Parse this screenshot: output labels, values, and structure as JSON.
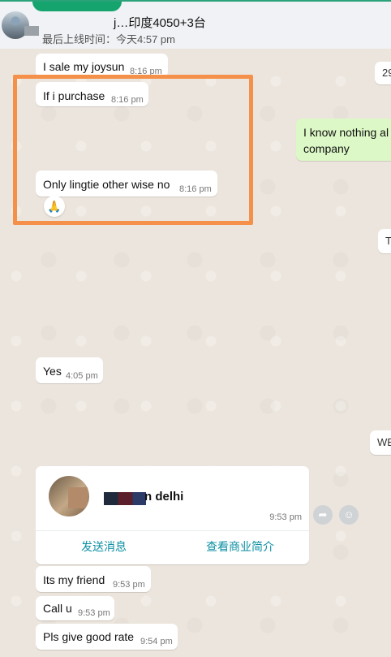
{
  "header": {
    "contact_name": "j…印度4050+3台",
    "last_seen": "最后上线时间：今天4:57 pm"
  },
  "messages": [
    {
      "text": "I sale my joysun",
      "time": "8:16 pm"
    },
    {
      "text": "If i purchase",
      "time": "8:16 pm"
    },
    {
      "text": "Only lingtie other wise no",
      "time": "8:16 pm"
    },
    {
      "text": "Yes",
      "time": "4:05 pm"
    },
    {
      "text": "Its my friend",
      "time": "9:53 pm"
    },
    {
      "text": "Call u",
      "time": "9:53 pm"
    },
    {
      "text": "Pls give good rate",
      "time": "9:54 pm"
    }
  ],
  "outgoing": {
    "line1": "I know nothing al",
    "line2": "company"
  },
  "edge_fragments": {
    "top": "29",
    "mid": "T",
    "we": "WE"
  },
  "reaction_emoji": "🙏",
  "contact_card": {
    "name_suffix": "n delhi",
    "time": "9:53 pm",
    "action_message": "发送消息",
    "action_business": "查看商业简介"
  },
  "icons": {
    "forward": "forward-icon",
    "emoji_react": "emoji-icon"
  }
}
